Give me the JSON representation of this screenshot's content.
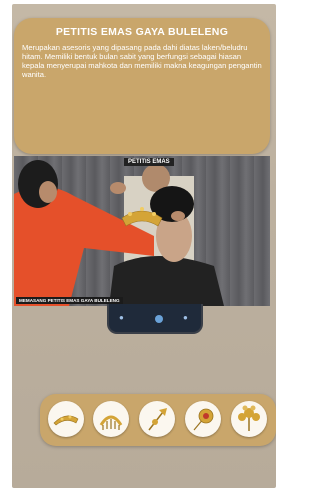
{
  "info": {
    "title": "PETITIS EMAS GAYA BULELENG",
    "description": "Merupakan asesoris yang dipasang pada dahi diatas laken/beludru hitam. Memiliki bentuk bulan sabit yang berfungsi sebagai hiasan kepala menyerupai mahkota dan memiliki makna keagungan pengantin wanita."
  },
  "video": {
    "label": "PETITIS EMAS",
    "caption": "MEMASANG PETITIS EMAS GAYA BULELENG"
  },
  "ornaments": [
    {
      "icon": "petitis-ornament-icon"
    },
    {
      "icon": "crown-ornament-icon"
    },
    {
      "icon": "hairpin-ornament-icon"
    },
    {
      "icon": "flower-pin-ornament-icon"
    },
    {
      "icon": "hair-flower-ornament-icon"
    }
  ],
  "colors": {
    "panel": "#c9a66b",
    "gold": "#d4a437"
  }
}
